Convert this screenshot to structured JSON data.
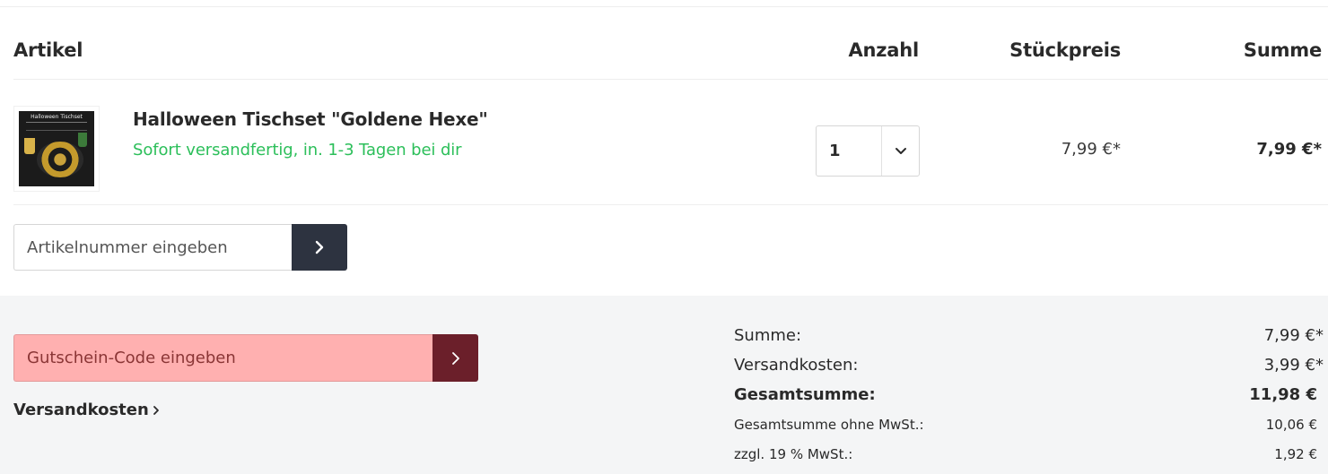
{
  "table": {
    "headers": {
      "article": "Artikel",
      "quantity": "Anzahl",
      "unit_price": "Stückpreis",
      "sum": "Summe"
    },
    "items": [
      {
        "name": "Halloween Tischset \"Goldene Hexe\"",
        "delivery": "Sofort versandfertig, in. 1-3 Tagen bei dir",
        "thumbnail_title": "Halloween Tischset",
        "quantity": "1",
        "unit_price": "7,99 €*",
        "total": "7,99 €*"
      }
    ]
  },
  "add_article": {
    "placeholder": "Artikelnummer eingeben",
    "button_icon": "chevron-right-icon"
  },
  "voucher": {
    "placeholder": "Gutschein-Code eingeben",
    "button_icon": "chevron-right-icon"
  },
  "shipping_link": {
    "label": "Versandkosten",
    "icon": "chevron-right-icon"
  },
  "summary": {
    "subtotal_label": "Summe:",
    "subtotal_value": "7,99 €*",
    "shipping_label": "Versandkosten:",
    "shipping_value": "3,99 €*",
    "total_label": "Gesamtsumme:",
    "total_value": "11,98 €",
    "net_label": "Gesamtsumme ohne MwSt.:",
    "net_value": "10,06 €",
    "tax_label": "zzgl. 19 % MwSt.:",
    "tax_value": "1,92 €"
  },
  "colors": {
    "in_stock": "#2cbf5a",
    "dark_button": "#2d3340",
    "voucher_bg": "#ffb0b0",
    "voucher_button": "#6b1f2a",
    "panel_bg": "#f4f5f6"
  }
}
